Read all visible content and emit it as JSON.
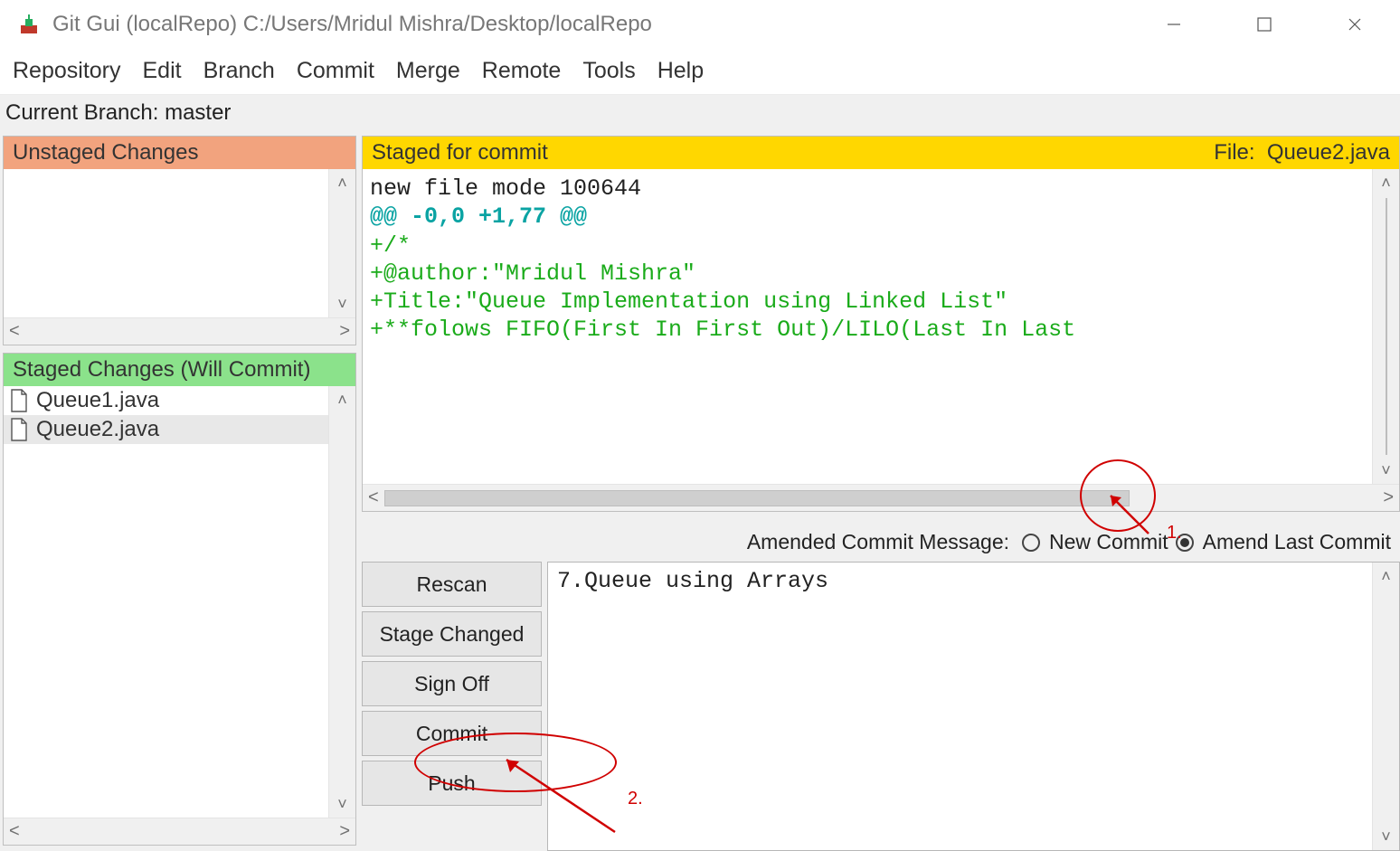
{
  "window": {
    "title": "Git Gui (localRepo) C:/Users/Mridul Mishra/Desktop/localRepo"
  },
  "menu": {
    "items": [
      "Repository",
      "Edit",
      "Branch",
      "Commit",
      "Merge",
      "Remote",
      "Tools",
      "Help"
    ]
  },
  "branch_bar": {
    "text": "Current Branch: master"
  },
  "panels": {
    "unstaged_header": "Unstaged Changes",
    "staged_list_header": "Staged Changes (Will Commit)",
    "diff_header_left": "Staged for commit",
    "diff_header_right_label": "File:",
    "diff_header_right_value": "Queue2.java"
  },
  "staged_files": [
    {
      "name": "Queue1.java",
      "selected": false
    },
    {
      "name": "Queue2.java",
      "selected": true
    }
  ],
  "diff_lines": [
    {
      "text": "new file mode 100644",
      "cls": ""
    },
    {
      "text": "@@ -0,0 +1,77 @@",
      "cls": "teal"
    },
    {
      "text": "+/*",
      "cls": "green"
    },
    {
      "text": "+@author:\"Mridul Mishra\"",
      "cls": "green"
    },
    {
      "text": "+Title:\"Queue Implementation using Linked List\"",
      "cls": "green"
    },
    {
      "text": "+**folows FIFO(First In First Out)/LILO(Last In Last",
      "cls": "green"
    }
  ],
  "commit": {
    "opts_label": "Amended Commit Message:",
    "radio_new_label": "New Commit",
    "radio_amend_label": "Amend Last Commit",
    "selected": "amend",
    "message": "7.Queue using Arrays",
    "buttons": {
      "rescan": "Rescan",
      "stage_changed": "Stage Changed",
      "sign_off": "Sign Off",
      "commit": "Commit",
      "push": "Push"
    }
  },
  "annotations": {
    "label1": "1.",
    "label2": "2."
  }
}
